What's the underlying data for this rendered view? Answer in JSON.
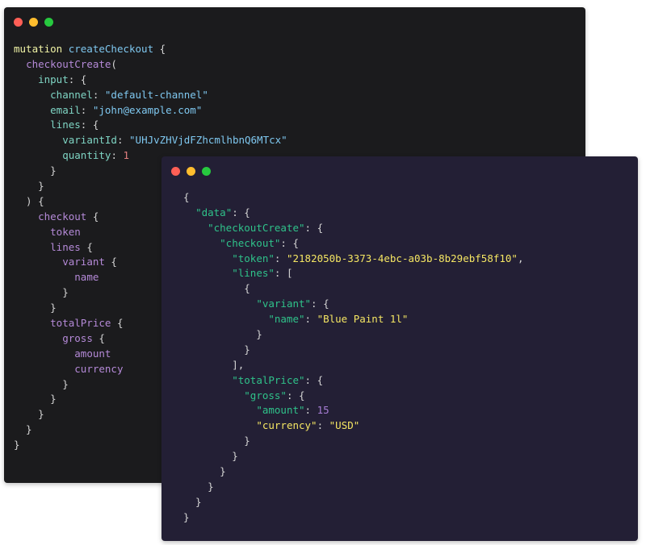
{
  "query_window": {
    "lines": [
      [
        {
          "t": "mutation ",
          "c": "kw"
        },
        {
          "t": "createCheckout",
          "c": "fn"
        },
        {
          "t": " {",
          "c": "punc"
        }
      ],
      [
        {
          "t": "  ",
          "c": "punc"
        },
        {
          "t": "checkoutCreate",
          "c": "fld"
        },
        {
          "t": "(",
          "c": "punc"
        }
      ],
      [
        {
          "t": "    ",
          "c": "punc"
        },
        {
          "t": "input",
          "c": "arg"
        },
        {
          "t": ": {",
          "c": "punc"
        }
      ],
      [
        {
          "t": "      ",
          "c": "punc"
        },
        {
          "t": "channel",
          "c": "arg"
        },
        {
          "t": ": ",
          "c": "punc"
        },
        {
          "t": "\"default-channel\"",
          "c": "str"
        }
      ],
      [
        {
          "t": "      ",
          "c": "punc"
        },
        {
          "t": "email",
          "c": "arg"
        },
        {
          "t": ": ",
          "c": "punc"
        },
        {
          "t": "\"john@example.com\"",
          "c": "str"
        }
      ],
      [
        {
          "t": "      ",
          "c": "punc"
        },
        {
          "t": "lines",
          "c": "arg"
        },
        {
          "t": ": {",
          "c": "punc"
        }
      ],
      [
        {
          "t": "        ",
          "c": "punc"
        },
        {
          "t": "variantId",
          "c": "arg"
        },
        {
          "t": ": ",
          "c": "punc"
        },
        {
          "t": "\"UHJvZHVjdFZhcmlhbnQ6MTcx\"",
          "c": "str"
        }
      ],
      [
        {
          "t": "        ",
          "c": "punc"
        },
        {
          "t": "quantity",
          "c": "arg"
        },
        {
          "t": ": ",
          "c": "punc"
        },
        {
          "t": "1",
          "c": "num"
        }
      ],
      [
        {
          "t": "      }",
          "c": "punc"
        }
      ],
      [
        {
          "t": "    }",
          "c": "punc"
        }
      ],
      [
        {
          "t": "  ) {",
          "c": "punc"
        }
      ],
      [
        {
          "t": "    ",
          "c": "punc"
        },
        {
          "t": "checkout",
          "c": "fld"
        },
        {
          "t": " {",
          "c": "punc"
        }
      ],
      [
        {
          "t": "      ",
          "c": "punc"
        },
        {
          "t": "token",
          "c": "fld"
        }
      ],
      [
        {
          "t": "      ",
          "c": "punc"
        },
        {
          "t": "lines",
          "c": "fld"
        },
        {
          "t": " {",
          "c": "punc"
        }
      ],
      [
        {
          "t": "        ",
          "c": "punc"
        },
        {
          "t": "variant",
          "c": "fld"
        },
        {
          "t": " {",
          "c": "punc"
        }
      ],
      [
        {
          "t": "          ",
          "c": "punc"
        },
        {
          "t": "name",
          "c": "fld"
        }
      ],
      [
        {
          "t": "        }",
          "c": "punc"
        }
      ],
      [
        {
          "t": "      }",
          "c": "punc"
        }
      ],
      [
        {
          "t": "      ",
          "c": "punc"
        },
        {
          "t": "totalPrice",
          "c": "fld"
        },
        {
          "t": " {",
          "c": "punc"
        }
      ],
      [
        {
          "t": "        ",
          "c": "punc"
        },
        {
          "t": "gross",
          "c": "fld"
        },
        {
          "t": " {",
          "c": "punc"
        }
      ],
      [
        {
          "t": "          ",
          "c": "punc"
        },
        {
          "t": "amount",
          "c": "fld"
        }
      ],
      [
        {
          "t": "          ",
          "c": "punc"
        },
        {
          "t": "currency",
          "c": "fld"
        }
      ],
      [
        {
          "t": "        }",
          "c": "punc"
        }
      ],
      [
        {
          "t": "      }",
          "c": "punc"
        }
      ],
      [
        {
          "t": "    }",
          "c": "punc"
        }
      ],
      [
        {
          "t": "  }",
          "c": "punc"
        }
      ],
      [
        {
          "t": "}",
          "c": "punc"
        }
      ]
    ]
  },
  "response_window": {
    "lines": [
      [
        {
          "t": "{",
          "c": "punc"
        }
      ],
      [
        {
          "t": "  ",
          "c": "punc"
        },
        {
          "t": "\"data\"",
          "c": "jkey"
        },
        {
          "t": ": {",
          "c": "punc"
        }
      ],
      [
        {
          "t": "    ",
          "c": "punc"
        },
        {
          "t": "\"checkoutCreate\"",
          "c": "jkey"
        },
        {
          "t": ": {",
          "c": "punc"
        }
      ],
      [
        {
          "t": "      ",
          "c": "punc"
        },
        {
          "t": "\"checkout\"",
          "c": "jkey"
        },
        {
          "t": ": {",
          "c": "punc"
        }
      ],
      [
        {
          "t": "        ",
          "c": "punc"
        },
        {
          "t": "\"token\"",
          "c": "jkey"
        },
        {
          "t": ": ",
          "c": "punc"
        },
        {
          "t": "\"2182050b-3373-4ebc-a03b-8b29ebf58f10\"",
          "c": "jstr"
        },
        {
          "t": ",",
          "c": "punc"
        }
      ],
      [
        {
          "t": "        ",
          "c": "punc"
        },
        {
          "t": "\"lines\"",
          "c": "jkey"
        },
        {
          "t": ": [",
          "c": "punc"
        }
      ],
      [
        {
          "t": "          {",
          "c": "punc"
        }
      ],
      [
        {
          "t": "            ",
          "c": "punc"
        },
        {
          "t": "\"variant\"",
          "c": "jkey"
        },
        {
          "t": ": {",
          "c": "punc"
        }
      ],
      [
        {
          "t": "              ",
          "c": "punc"
        },
        {
          "t": "\"name\"",
          "c": "jkey"
        },
        {
          "t": ": ",
          "c": "punc"
        },
        {
          "t": "\"Blue Paint 1l\"",
          "c": "jstr"
        }
      ],
      [
        {
          "t": "            }",
          "c": "punc"
        }
      ],
      [
        {
          "t": "          }",
          "c": "punc"
        }
      ],
      [
        {
          "t": "        ],",
          "c": "punc"
        }
      ],
      [
        {
          "t": "        ",
          "c": "punc"
        },
        {
          "t": "\"totalPrice\"",
          "c": "jkey"
        },
        {
          "t": ": {",
          "c": "punc"
        }
      ],
      [
        {
          "t": "          ",
          "c": "punc"
        },
        {
          "t": "\"gross\"",
          "c": "jkey"
        },
        {
          "t": ": {",
          "c": "punc"
        }
      ],
      [
        {
          "t": "            ",
          "c": "punc"
        },
        {
          "t": "\"amount\"",
          "c": "jkey"
        },
        {
          "t": ": ",
          "c": "punc"
        },
        {
          "t": "15",
          "c": "jnum"
        }
      ],
      [
        {
          "t": "            ",
          "c": "punc"
        },
        {
          "t": "\"currency\"",
          "c": "jkey2"
        },
        {
          "t": ": ",
          "c": "punc"
        },
        {
          "t": "\"USD\"",
          "c": "jstr"
        }
      ],
      [
        {
          "t": "          }",
          "c": "punc"
        }
      ],
      [
        {
          "t": "        }",
          "c": "punc"
        }
      ],
      [
        {
          "t": "      }",
          "c": "punc"
        }
      ],
      [
        {
          "t": "    }",
          "c": "punc"
        }
      ],
      [
        {
          "t": "  }",
          "c": "punc"
        }
      ],
      [
        {
          "t": "}",
          "c": "punc"
        }
      ]
    ]
  }
}
